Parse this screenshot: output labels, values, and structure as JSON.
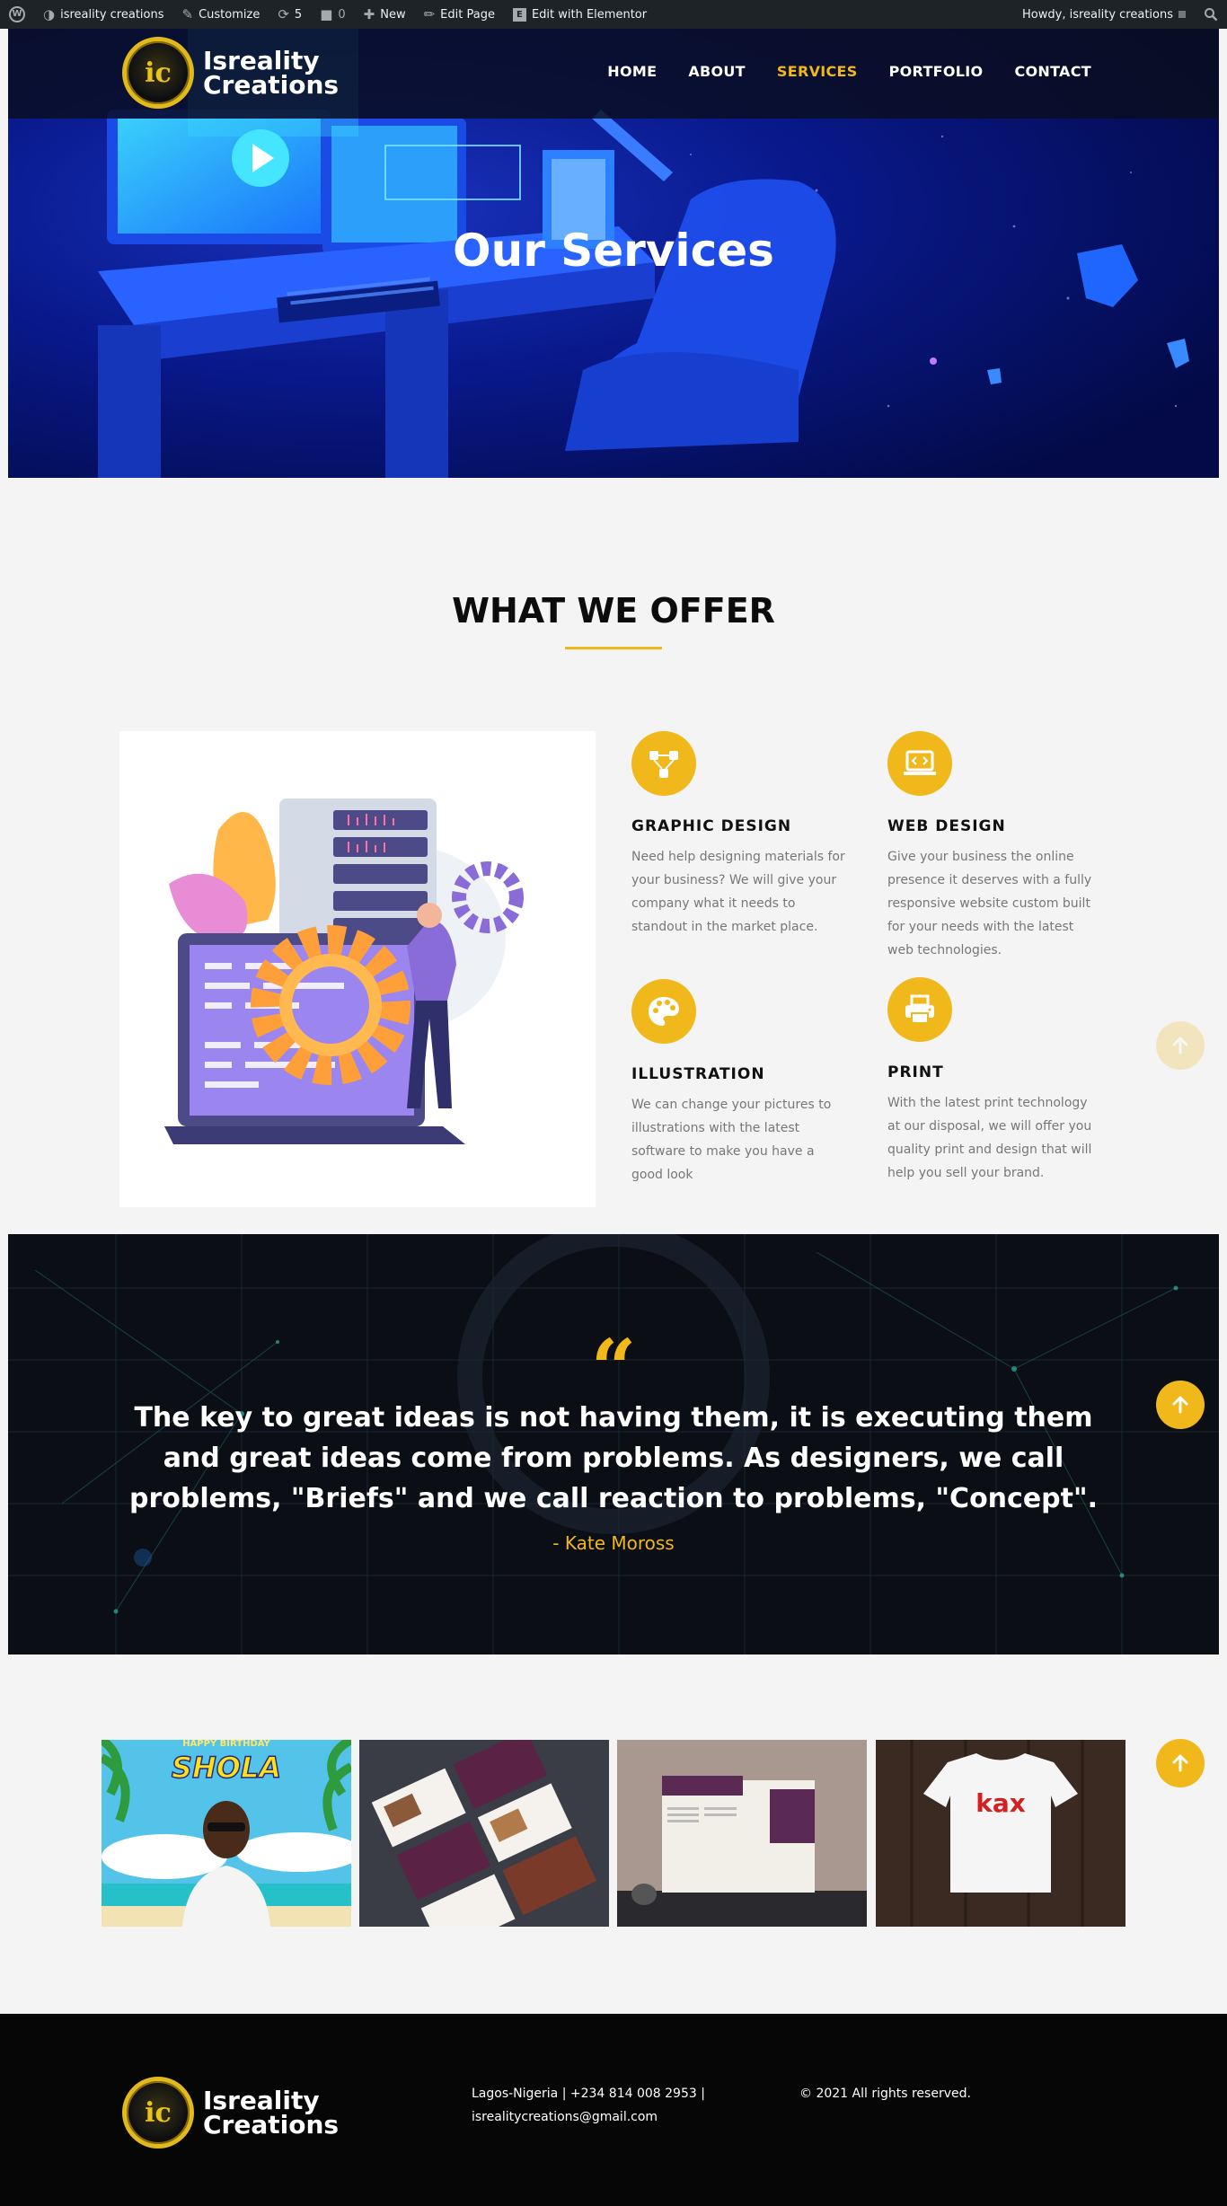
{
  "admin_bar": {
    "site_name": "isreality creations",
    "customize": "Customize",
    "updates_count": "5",
    "comments_count": "0",
    "new": "New",
    "edit_page": "Edit Page",
    "edit_elementor": "Edit with Elementor",
    "howdy": "Howdy, isreality creations"
  },
  "header": {
    "logo": {
      "mark": "ic",
      "line1": "Isreality",
      "line2": "Creations"
    },
    "nav": [
      {
        "label": "HOME",
        "active": false
      },
      {
        "label": "ABOUT",
        "active": false
      },
      {
        "label": "SERVICES",
        "active": true
      },
      {
        "label": "PORTFOLIO",
        "active": false
      },
      {
        "label": "CONTACT",
        "active": false
      }
    ]
  },
  "hero": {
    "title": "Our Services"
  },
  "offer": {
    "title": "WHAT WE OFFER",
    "services": [
      {
        "icon": "network-icon",
        "title": "GRAPHIC DESIGN",
        "description": "Need help designing materials for your business? We will give your company what it needs to standout in the market place."
      },
      {
        "icon": "laptop-code-icon",
        "title": "WEB DESIGN",
        "description": "Give your business the online presence it deserves with a fully responsive website custom built for your needs with the latest web technologies."
      },
      {
        "icon": "palette-icon",
        "title": "ILLUSTRATION",
        "description": "We can change your pictures to illustrations with the latest software to make you have a good look"
      },
      {
        "icon": "printer-icon",
        "title": "PRINT",
        "description": "With the latest print technology at our disposal, we will offer you quality print and design that will help you sell your brand."
      }
    ]
  },
  "quote": {
    "mark": "“",
    "text": "The key to great ideas is not having them, it is executing them and great ideas come from problems. As designers, we call problems, \"Briefs\" and we call reaction to problems, \"Concept\".",
    "author": "- Kate Moross"
  },
  "portfolio": {
    "items": [
      {
        "name": "birthday-flyer",
        "headline": "HAPPY BIRTHDAY",
        "title": "SHOLA"
      },
      {
        "name": "brochure-mockup"
      },
      {
        "name": "magazine-mockup"
      },
      {
        "name": "tshirt-mockup",
        "brand": "kax"
      }
    ]
  },
  "footer": {
    "logo": {
      "mark": "ic",
      "line1": "Isreality",
      "line2": "Creations"
    },
    "contact_line1": "Lagos-Nigeria | +234 814 008 2953 |",
    "contact_line2": "isrealitycreations@gmail.com",
    "copyright": "© 2021 All rights reserved."
  },
  "colors": {
    "accent": "#f0b81a",
    "hero_blue": "#0a1a8c",
    "admin_bar": "#1d2327",
    "footer": "#060606"
  }
}
